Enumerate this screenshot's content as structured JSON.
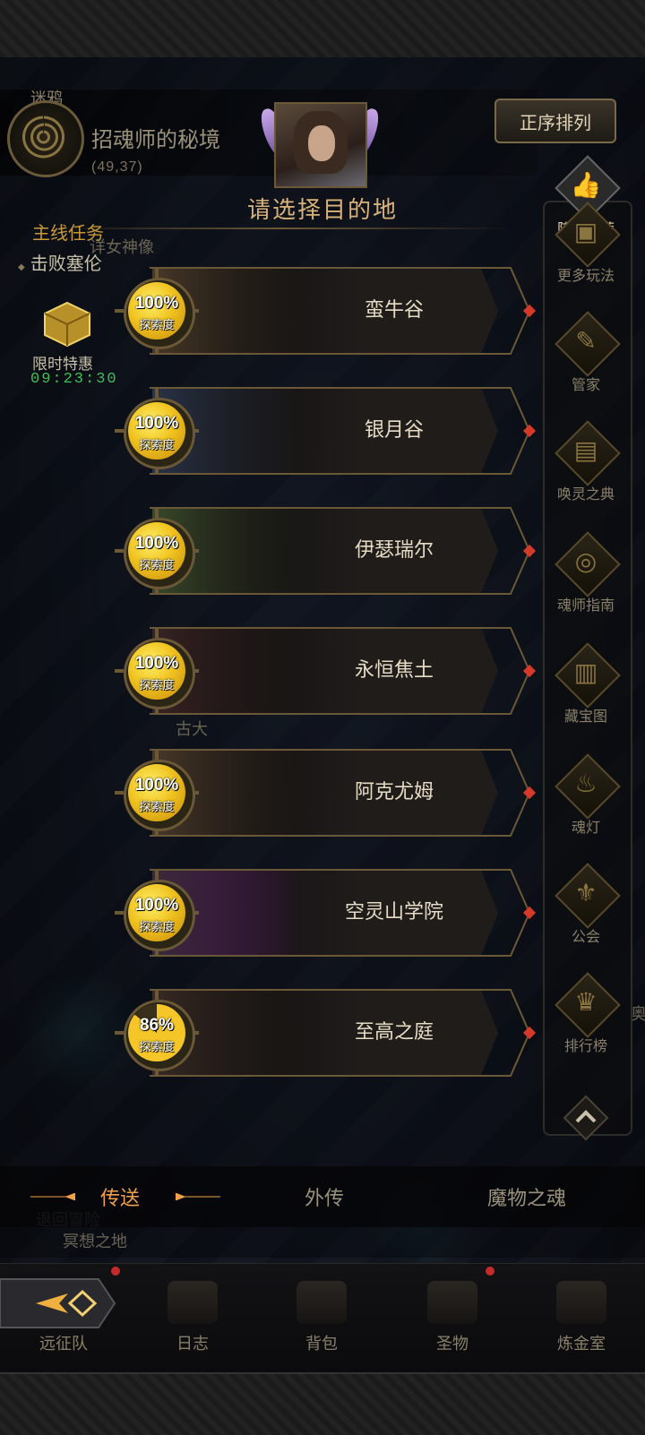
{
  "header": {
    "left_small_label": "迷鸦",
    "map_name": "招魂师的秘境",
    "map_coords": "(49,37)",
    "title": "请选择目的地",
    "sort_button": "正序排列"
  },
  "quests": {
    "main_label": "主线任务",
    "objective": "击败塞伦"
  },
  "promo": {
    "label": "限时特惠",
    "timer": "09:23:30"
  },
  "background_texts": {
    "statue": "详女神像",
    "south": "古大",
    "exit": "退回冒险",
    "area": "冥想之地",
    "mark_right": "奥"
  },
  "side_menu": [
    {
      "label": "阵容推荐",
      "icon": "thumbs-up-icon"
    },
    {
      "label": "更多玩法",
      "icon": "gift-box-icon"
    },
    {
      "label": "管家",
      "icon": "quill-scroll-icon"
    },
    {
      "label": "唤灵之典",
      "icon": "tome-icon"
    },
    {
      "label": "魂师指南",
      "icon": "guide-emblem-icon"
    },
    {
      "label": "藏宝图",
      "icon": "treasure-map-icon"
    },
    {
      "label": "魂灯",
      "icon": "lamp-icon"
    },
    {
      "label": "公会",
      "icon": "guild-crest-icon"
    },
    {
      "label": "排行榜",
      "icon": "trophy-icon"
    }
  ],
  "destinations": [
    {
      "name": "蛮牛谷",
      "progress": "100%",
      "progress_value": 100,
      "explore_label": "探索度"
    },
    {
      "name": "银月谷",
      "progress": "100%",
      "progress_value": 100,
      "explore_label": "探索度"
    },
    {
      "name": "伊瑟瑞尔",
      "progress": "100%",
      "progress_value": 100,
      "explore_label": "探索度"
    },
    {
      "name": "永恒焦土",
      "progress": "100%",
      "progress_value": 100,
      "explore_label": "探索度"
    },
    {
      "name": "阿克尤姆",
      "progress": "100%",
      "progress_value": 100,
      "explore_label": "探索度"
    },
    {
      "name": "空灵山学院",
      "progress": "100%",
      "progress_value": 100,
      "explore_label": "探索度"
    },
    {
      "name": "至高之庭",
      "progress": "86%",
      "progress_value": 86,
      "explore_label": "探索度"
    }
  ],
  "tabs": [
    {
      "label": "传送",
      "active": true
    },
    {
      "label": "外传",
      "active": false
    },
    {
      "label": "魔物之魂",
      "active": false
    }
  ],
  "bottom_nav": [
    {
      "label": "远征队",
      "icon": "expedition-icon",
      "badge": true
    },
    {
      "label": "日志",
      "icon": "journal-icon",
      "badge": false
    },
    {
      "label": "背包",
      "icon": "backpack-icon",
      "badge": false
    },
    {
      "label": "圣物",
      "icon": "relic-icon",
      "badge": true
    },
    {
      "label": "炼金室",
      "icon": "alchemy-icon",
      "badge": false
    }
  ],
  "colors": {
    "accent_gold": "#d9b27a",
    "tab_active": "#f0a04a",
    "timer_green": "#3fbf5a",
    "badge_red": "#d43a2a"
  }
}
